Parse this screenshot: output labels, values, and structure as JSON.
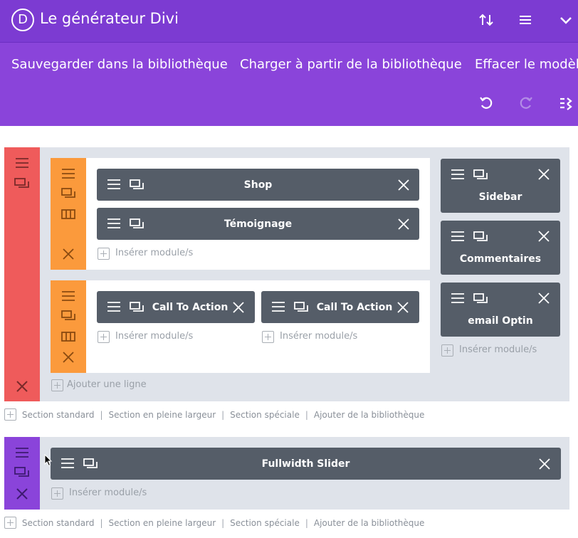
{
  "header": {
    "logo_letter": "D",
    "title": "Le générateur Divi"
  },
  "menu": {
    "save": "Sauvegarder dans la bibliothèque",
    "load": "Charger à partir de la bibliothèque",
    "clear": "Effacer le modèle"
  },
  "modules": {
    "shop": "Shop",
    "testimonial": "Témoignage",
    "cta1": "Call To Action",
    "cta2": "Call To Action",
    "sidebar": "Sidebar",
    "comments": "Commentaires",
    "optin": "email Optin",
    "slider": "Fullwidth Slider"
  },
  "labels": {
    "insert_modules": "Insérer module/s",
    "add_row": "Ajouter une ligne",
    "section_standard": "Section standard",
    "section_fullwidth": "Section en pleine largeur",
    "section_special": "Section spéciale",
    "add_from_library": "Ajouter de la bibliothèque",
    "separator": "|"
  },
  "colors": {
    "header": "#7c3bd2",
    "menubar": "#8a44da",
    "section_red": "#ef5b5b",
    "row_orange": "#fb9a3c",
    "module": "#555d68"
  }
}
